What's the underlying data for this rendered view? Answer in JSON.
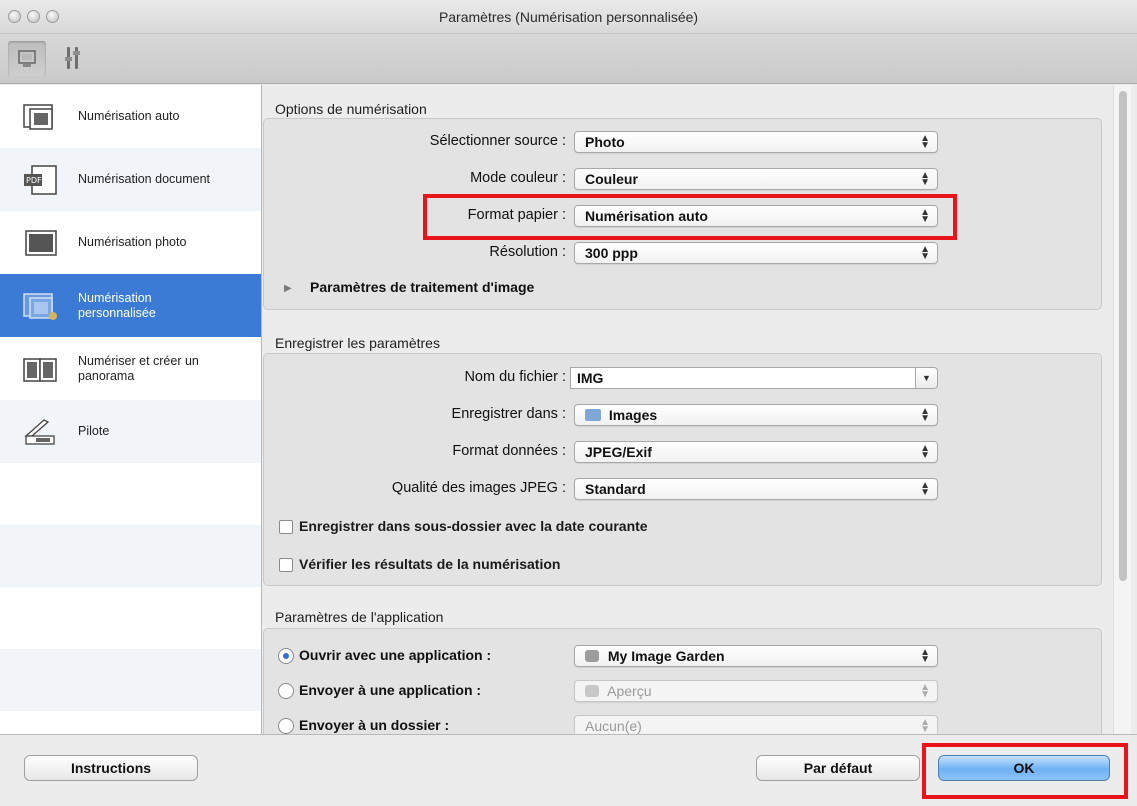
{
  "window": {
    "title": "Paramètres (Numérisation personnalisée)"
  },
  "toolbar": {
    "buttons": [
      {
        "icon": "scan-settings-icon"
      },
      {
        "icon": "general-settings-icon"
      }
    ]
  },
  "sidebar": {
    "items": [
      {
        "label": "Numérisation auto",
        "icon": "auto-scan-icon"
      },
      {
        "label": "Numérisation document",
        "icon": "document-scan-icon"
      },
      {
        "label": "Numérisation photo",
        "icon": "photo-scan-icon"
      },
      {
        "label": "Numérisation personnalisée",
        "icon": "custom-scan-icon",
        "active": true
      },
      {
        "label": "Numériser et créer un panorama",
        "icon": "panorama-icon"
      },
      {
        "label": "Pilote",
        "icon": "driver-icon"
      }
    ]
  },
  "scan_options": {
    "title": "Options de numérisation",
    "source": {
      "label": "Sélectionner source :",
      "value": "Photo"
    },
    "color_mode": {
      "label": "Mode couleur :",
      "value": "Couleur"
    },
    "paper_size": {
      "label": "Format papier :",
      "value": "Numérisation auto"
    },
    "resolution": {
      "label": "Résolution :",
      "value": "300 ppp"
    },
    "image_processing": {
      "label": "Paramètres de traitement d'image"
    }
  },
  "save_settings": {
    "title": "Enregistrer les paramètres",
    "filename": {
      "label": "Nom du fichier :",
      "value": "IMG"
    },
    "save_in": {
      "label": "Enregistrer dans :",
      "value": "Images"
    },
    "data_format": {
      "label": "Format données :",
      "value": "JPEG/Exif"
    },
    "jpeg_quality": {
      "label": "Qualité des images JPEG :",
      "value": "Standard"
    },
    "subfolder_checkbox": {
      "label": "Enregistrer dans sous-dossier avec la date courante",
      "checked": false
    },
    "check_results_checkbox": {
      "label": "Vérifier les résultats de la numérisation",
      "checked": false
    }
  },
  "app_settings": {
    "title": "Paramètres de l'application",
    "open_with": {
      "label": "Ouvrir avec une application :",
      "value": "My Image Garden",
      "selected": true
    },
    "send_to_app": {
      "label": "Envoyer à une application :",
      "value": "Aperçu",
      "selected": false
    },
    "send_to_folder": {
      "label": "Envoyer à un dossier :",
      "value": "Aucun(e)",
      "selected": false
    }
  },
  "footer": {
    "instructions": "Instructions",
    "default": "Par défaut",
    "ok": "OK"
  },
  "colors": {
    "selection": "#3b7bd5",
    "highlight": "#e8131b"
  }
}
